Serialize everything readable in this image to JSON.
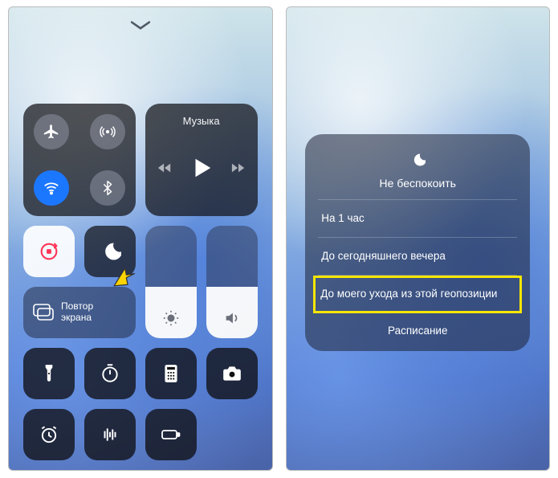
{
  "left": {
    "music_label": "Музыка",
    "screen_mirror_line1": "Повтор",
    "screen_mirror_line2": "экрана",
    "brightness_fill_pct": 46,
    "volume_fill_pct": 46
  },
  "right": {
    "title": "Не беспокоить",
    "options": [
      "На 1 час",
      "До сегодняшнего вечера",
      "До моего ухода из этой геопозиции"
    ],
    "highlight_index": 2,
    "schedule_label": "Расписание"
  }
}
